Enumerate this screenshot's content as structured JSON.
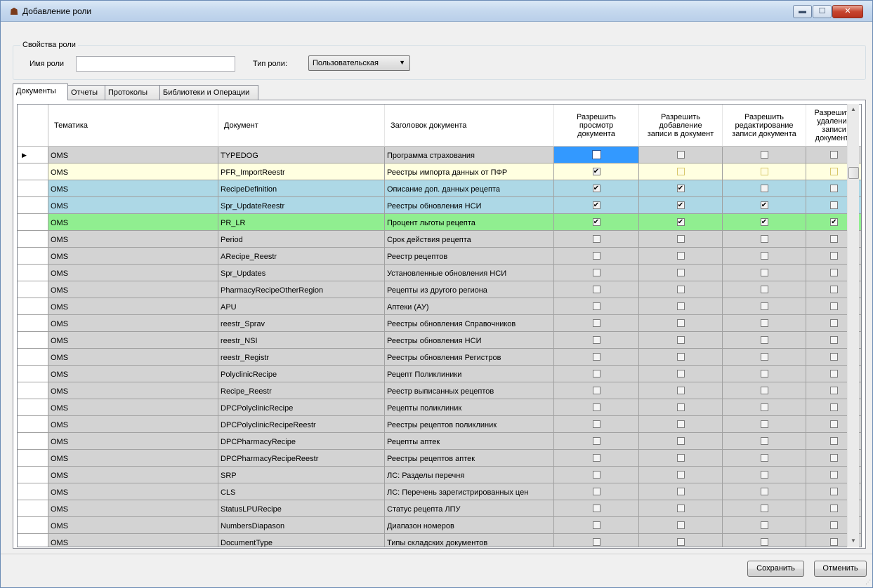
{
  "window": {
    "title": "Добавление роли",
    "icon": "role-app-icon",
    "controls": {
      "minimize": "▬",
      "maximize": "☐",
      "close": "✕"
    }
  },
  "role_props": {
    "group_label": "Свойства роли",
    "name_label": "Имя роли",
    "name_value": "",
    "type_label": "Тип роли:",
    "type_value": "Пользовательская"
  },
  "tabs": [
    {
      "label": "Документы",
      "active": true
    },
    {
      "label": "Отчеты",
      "active": false
    },
    {
      "label": "Протоколы",
      "active": false
    },
    {
      "label": "Библиотеки и Операции",
      "active": false
    }
  ],
  "grid": {
    "columns": [
      "Тематика",
      "Документ",
      "Заголовок документа",
      "Разрешить просмотр документа",
      "Разрешить добавление записи в документ",
      "Разрешить редактирование записи документа",
      "Разрешить удаление записи документа"
    ],
    "current_row_marker": "▶",
    "rows": [
      {
        "theme": "OMS",
        "doc": "TYPEDOG",
        "title": "Программа страхования",
        "perm": [
          false,
          false,
          false,
          false
        ],
        "style": "gray",
        "selected_cell": 0
      },
      {
        "theme": "OMS",
        "doc": "PFR_ImportReestr",
        "title": "Реестры импорта данных от ПФР",
        "perm": [
          true,
          false,
          false,
          false
        ],
        "style": "yellow"
      },
      {
        "theme": "OMS",
        "doc": "RecipeDefinition",
        "title": "Описание доп. данных рецепта",
        "perm": [
          true,
          true,
          false,
          false
        ],
        "style": "blue"
      },
      {
        "theme": "OMS",
        "doc": "Spr_UpdateReestr",
        "title": "Реестры обновления НСИ",
        "perm": [
          true,
          true,
          true,
          false
        ],
        "style": "blue"
      },
      {
        "theme": "OMS",
        "doc": "PR_LR",
        "title": "Процент льготы рецепта",
        "perm": [
          true,
          true,
          true,
          true
        ],
        "style": "green"
      },
      {
        "theme": "OMS",
        "doc": "Period",
        "title": "Срок действия рецепта",
        "perm": [
          false,
          false,
          false,
          false
        ],
        "style": "gray"
      },
      {
        "theme": "OMS",
        "doc": "ARecipe_Reestr",
        "title": "Реестр рецептов",
        "perm": [
          false,
          false,
          false,
          false
        ],
        "style": "gray"
      },
      {
        "theme": "OMS",
        "doc": "Spr_Updates",
        "title": "Установленные обновления НСИ",
        "perm": [
          false,
          false,
          false,
          false
        ],
        "style": "gray"
      },
      {
        "theme": "OMS",
        "doc": "PharmacyRecipeOtherRegion",
        "title": "Рецепты из другого региона",
        "perm": [
          false,
          false,
          false,
          false
        ],
        "style": "gray"
      },
      {
        "theme": "OMS",
        "doc": "APU",
        "title": "Аптеки (АУ)",
        "perm": [
          false,
          false,
          false,
          false
        ],
        "style": "gray"
      },
      {
        "theme": "OMS",
        "doc": "reestr_Sprav",
        "title": "Реестры обновления Справочников",
        "perm": [
          false,
          false,
          false,
          false
        ],
        "style": "gray"
      },
      {
        "theme": "OMS",
        "doc": "reestr_NSI",
        "title": "Реестры обновления НСИ",
        "perm": [
          false,
          false,
          false,
          false
        ],
        "style": "gray"
      },
      {
        "theme": "OMS",
        "doc": "reestr_Registr",
        "title": "Реестры обновления Регистров",
        "perm": [
          false,
          false,
          false,
          false
        ],
        "style": "gray"
      },
      {
        "theme": "OMS",
        "doc": "PolyclinicRecipe",
        "title": "Рецепт Поликлиники",
        "perm": [
          false,
          false,
          false,
          false
        ],
        "style": "gray"
      },
      {
        "theme": "OMS",
        "doc": "Recipe_Reestr",
        "title": "Реестр выписанных рецептов",
        "perm": [
          false,
          false,
          false,
          false
        ],
        "style": "gray"
      },
      {
        "theme": "OMS",
        "doc": "DPCPolyclinicRecipe",
        "title": "Рецепты поликлиник",
        "perm": [
          false,
          false,
          false,
          false
        ],
        "style": "gray"
      },
      {
        "theme": "OMS",
        "doc": "DPCPolyclinicRecipeReestr",
        "title": "Реестры рецептов поликлиник",
        "perm": [
          false,
          false,
          false,
          false
        ],
        "style": "gray"
      },
      {
        "theme": "OMS",
        "doc": "DPCPharmacyRecipe",
        "title": "Рецепты аптек",
        "perm": [
          false,
          false,
          false,
          false
        ],
        "style": "gray"
      },
      {
        "theme": "OMS",
        "doc": "DPCPharmacyRecipeReestr",
        "title": "Реестры рецептов аптек",
        "perm": [
          false,
          false,
          false,
          false
        ],
        "style": "gray"
      },
      {
        "theme": "OMS",
        "doc": "SRP",
        "title": "ЛС: Разделы перечня",
        "perm": [
          false,
          false,
          false,
          false
        ],
        "style": "gray"
      },
      {
        "theme": "OMS",
        "doc": "CLS",
        "title": "ЛС: Перечень зарегистрированных цен",
        "perm": [
          false,
          false,
          false,
          false
        ],
        "style": "gray"
      },
      {
        "theme": "OMS",
        "doc": "StatusLPURecipe",
        "title": "Статус рецепта ЛПУ",
        "perm": [
          false,
          false,
          false,
          false
        ],
        "style": "gray"
      },
      {
        "theme": "OMS",
        "doc": "NumbersDiapason",
        "title": "Диапазон номеров",
        "perm": [
          false,
          false,
          false,
          false
        ],
        "style": "gray"
      },
      {
        "theme": "OMS",
        "doc": "DocumentType",
        "title": "Типы складских документов",
        "perm": [
          false,
          false,
          false,
          false
        ],
        "style": "gray"
      }
    ]
  },
  "colors": {
    "gray": "#d3d3d3",
    "yellow": "#ffffe0",
    "blue": "#add8e6",
    "green": "#90ee90",
    "selection": "#3399ff"
  },
  "buttons": {
    "save": "Сохранить",
    "cancel": "Отменить"
  },
  "check_glyph": "✔"
}
